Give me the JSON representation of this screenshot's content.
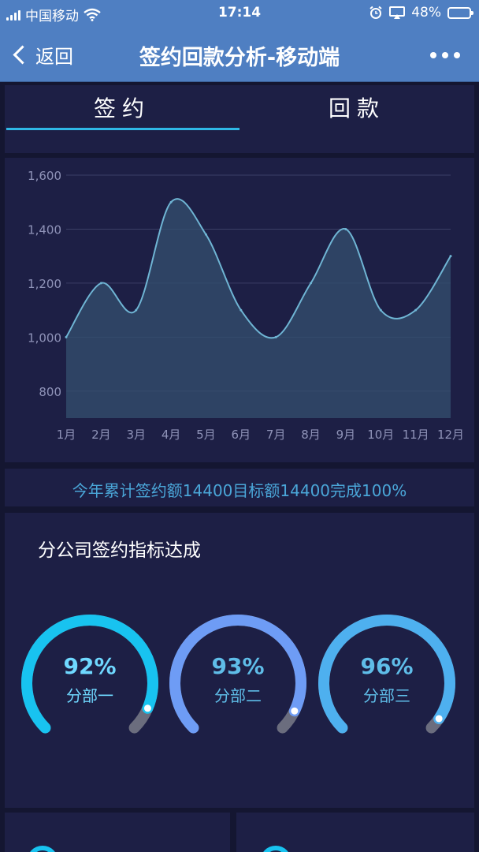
{
  "status_bar": {
    "carrier": "中国移动",
    "time": "17:14",
    "battery": "48%",
    "battery_level": 0.48
  },
  "nav": {
    "back_label": "返回",
    "title": "签约回款分析-移动端"
  },
  "tabs": [
    {
      "label": "签约",
      "active": true
    },
    {
      "label": "回款",
      "active": false
    }
  ],
  "chart_data": {
    "type": "area",
    "categories": [
      "1月",
      "2月",
      "3月",
      "4月",
      "5月",
      "6月",
      "7月",
      "8月",
      "9月",
      "10月",
      "11月",
      "12月"
    ],
    "series": [
      {
        "values": [
          1000,
          1200,
          1100,
          1500,
          1380,
          1100,
          1000,
          1200,
          1400,
          1100,
          1100,
          1300
        ]
      }
    ],
    "ylim": [
      700,
      1600
    ],
    "yticks": [
      800,
      1000,
      1200,
      1400,
      1600
    ],
    "ytick_labels": [
      "800",
      "1,000",
      "1,200",
      "1,400",
      "1,600"
    ],
    "grid": true,
    "colors": {
      "line": "#6fb5d4",
      "fill": "#34506f",
      "grid": "#3b3f66",
      "tick": "#8f93b8"
    }
  },
  "summary": {
    "text": "今年累计签约额14400目标额14400完成100%"
  },
  "section": {
    "title": "分公司签约指标达成"
  },
  "gauges": [
    {
      "value_text": "92%",
      "value": 0.92,
      "label": "分部一",
      "color": "#18c3f0",
      "text_color": "#6fd8ff"
    },
    {
      "value_text": "93%",
      "value": 0.93,
      "label": "分部二",
      "color": "#6e9cf5",
      "text_color": "#5fbde8"
    },
    {
      "value_text": "96%",
      "value": 0.96,
      "label": "分部三",
      "color": "#4eb0ef",
      "text_color": "#5fbde8"
    }
  ]
}
